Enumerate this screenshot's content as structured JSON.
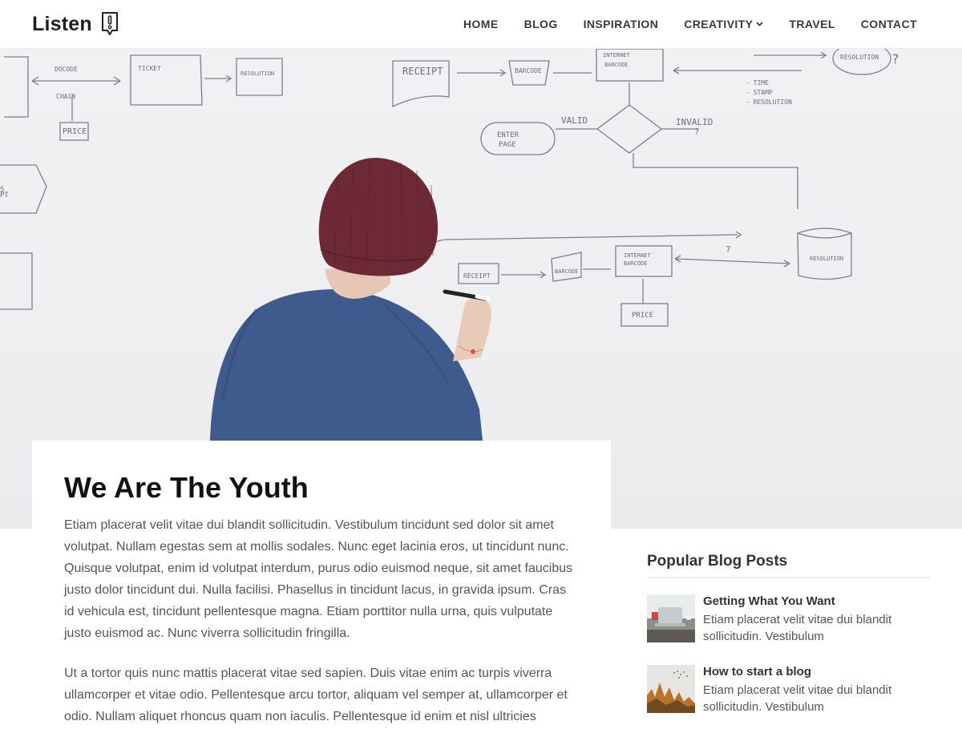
{
  "site": {
    "logo_text": "Listen",
    "logo_icon": "exclamation-badge-icon"
  },
  "nav": {
    "items": [
      {
        "label": "HOME"
      },
      {
        "label": "BLOG"
      },
      {
        "label": "INSPIRATION"
      },
      {
        "label": "CREATIVITY",
        "has_dropdown": true
      },
      {
        "label": "TRAVEL"
      },
      {
        "label": "CONTACT"
      }
    ]
  },
  "hero": {
    "image": "man-writing-flowchart-on-whiteboard",
    "whiteboard_labels": [
      "RECEIPT",
      "PRICE",
      "ENTER PAGE",
      "VALID",
      "INVALID ?",
      "INTERNET BARCODE",
      "RESOLUTION",
      "TIME STAMP"
    ]
  },
  "post": {
    "title": "We Are The Youth",
    "paragraphs": [
      "Etiam placerat velit vitae dui blandit sollicitudin. Vestibulum tincidunt sed dolor sit amet volutpat. Nullam egestas sem at mollis sodales. Nunc eget lacinia eros, ut tincidunt nunc. Quisque volutpat, enim id volutpat interdum, purus odio euismod neque, sit amet faucibus justo dolor tincidunt dui. Nulla facilisi. Phasellus in tincidunt lacus, in gravida ipsum. Cras id vehicula est, tincidunt pellentesque magna. Etiam porttitor nulla urna, quis vulputate justo euismod ac. Nunc viverra sollicitudin fringilla.",
      "Ut a tortor quis nunc mattis placerat vitae sed sapien. Duis vitae enim ac turpis viverra ullamcorper et vitae odio. Pellentesque arcu tortor, aliquam vel semper at, ullamcorper et odio. Nullam aliquet rhoncus quam non iaculis. Pellentesque id enim et nisl ultricies"
    ]
  },
  "sidebar": {
    "widget_title": "Popular Blog Posts",
    "posts": [
      {
        "title": "Getting What You Want",
        "excerpt": "Etiam placerat velit vitae dui blandit sollicitudin. Vestibulum",
        "thumb": "laptop-desk-thumbnail"
      },
      {
        "title": "How to start a blog",
        "excerpt": "Etiam placerat velit vitae dui blandit sollicitudin. Vestibulum",
        "thumb": "autumn-trees-birds-thumbnail"
      }
    ]
  },
  "colors": {
    "text_dark": "#111111",
    "text_body": "#555555",
    "nav_text": "#3a3a3a",
    "hat": "#6e2a34",
    "shirt": "#3f5a8c"
  }
}
